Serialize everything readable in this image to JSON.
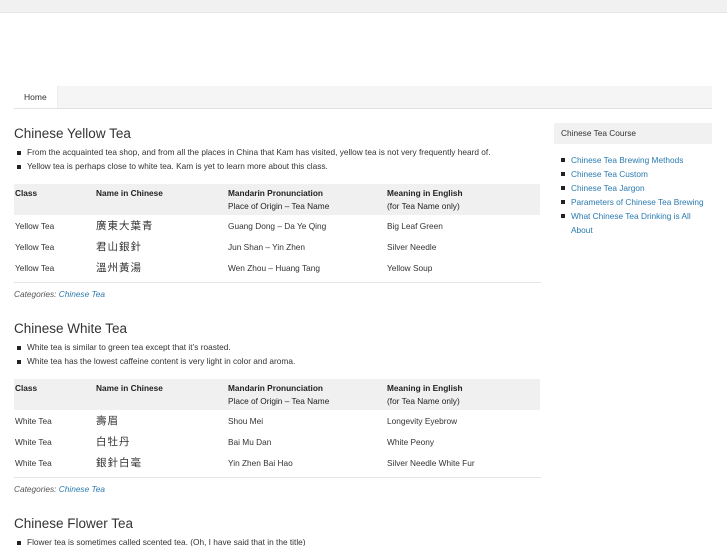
{
  "nav": {
    "home": "Home"
  },
  "posts": [
    {
      "title": "Chinese Yellow Tea",
      "bullets": [
        "From the acquainted tea shop, and from all the places in China that Kam has visited, yellow tea is not very frequently heard of.",
        "Yellow tea is perhaps close to white tea. Kam is yet to learn more about this class."
      ],
      "rows": [
        {
          "cls": "Yellow Tea",
          "cn": "廣東大葉青",
          "pron": "Guang Dong – Da Ye Qing",
          "meaning": "Big Leaf Green"
        },
        {
          "cls": "Yellow Tea",
          "cn": "君山銀針",
          "pron": "Jun Shan – Yin Zhen",
          "meaning": "Silver Needle"
        },
        {
          "cls": "Yellow Tea",
          "cn": "溫州黃湯",
          "pron": "Wen Zhou – Huang Tang",
          "meaning": "Yellow Soup"
        }
      ],
      "category": "Chinese Tea"
    },
    {
      "title": "Chinese White Tea",
      "bullets": [
        "White tea is similar to green tea except that it’s roasted.",
        "White tea has the lowest caffeine content is very light in color and aroma."
      ],
      "rows": [
        {
          "cls": "White Tea",
          "cn": "壽眉",
          "pron": "Shou Mei",
          "meaning": "Longevity Eyebrow"
        },
        {
          "cls": "White Tea",
          "cn": "白牡丹",
          "pron": "Bai Mu Dan",
          "meaning": "White Peony"
        },
        {
          "cls": "White Tea",
          "cn": "銀針白毫",
          "pron": "Yin Zhen Bai Hao",
          "meaning": "Silver Needle White Fur"
        }
      ],
      "category": "Chinese Tea"
    },
    {
      "title": "Chinese Flower Tea",
      "bullets": [
        "Flower tea is sometimes called scented tea. (Oh, I have said that in the title)"
      ]
    }
  ],
  "table_headers": {
    "cls": "Class",
    "cn": "Name in Chinese",
    "pron": "Mandarin Pronunciation",
    "pron_sub": "Place of Origin – Tea Name",
    "meaning": "Meaning in English",
    "meaning_sub": "(for Tea Name only)"
  },
  "categories_label": "Categories:",
  "sidebar": {
    "title": "Chinese Tea Course",
    "links": [
      "Chinese Tea Brewing Methods",
      "Chinese Tea Custom",
      "Chinese Tea Jargon",
      "Parameters of Chinese Tea Brewing",
      "What Chinese Tea Drinking is All About"
    ]
  }
}
